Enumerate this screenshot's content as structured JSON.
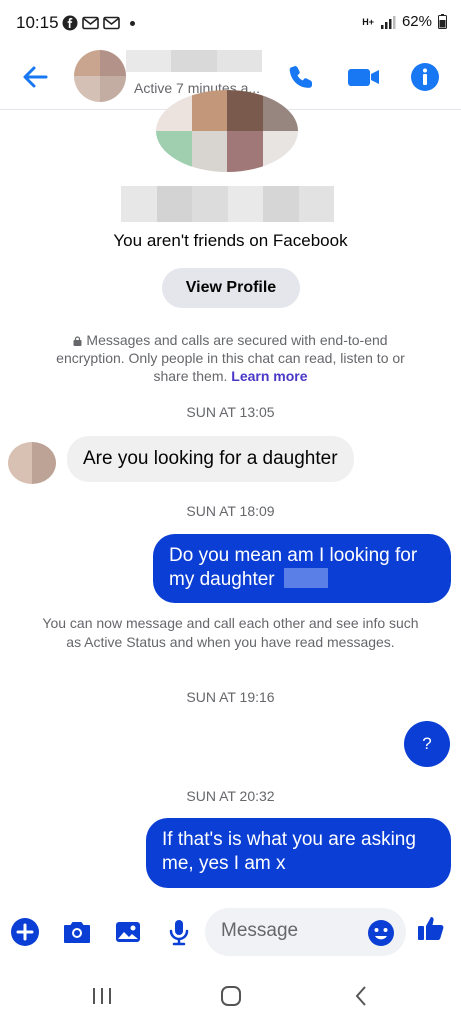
{
  "status_bar": {
    "time": "10:15",
    "network": "H+",
    "battery": "62%"
  },
  "header": {
    "subtitle": "Active 7 minutes a..."
  },
  "profile": {
    "not_friends_text": "You aren't friends on Facebook",
    "view_profile_label": "View Profile"
  },
  "encryption": {
    "text": "Messages and calls are secured with end-to-end encryption. Only people in this chat can read, listen to or share them.",
    "learn_more": "Learn more"
  },
  "conversation": [
    {
      "type": "timestamp",
      "text": "SUN AT 13:05"
    },
    {
      "type": "incoming",
      "text": "Are you looking for a daughter"
    },
    {
      "type": "timestamp",
      "text": "SUN AT 18:09"
    },
    {
      "type": "outgoing",
      "text": "Do you mean am I looking for my daughter"
    },
    {
      "type": "info",
      "text": "You can now message and call each other and see info such as Active Status and when you have read messages."
    },
    {
      "type": "timestamp",
      "text": "SUN AT 19:16"
    },
    {
      "type": "outgoing",
      "text": "?"
    },
    {
      "type": "timestamp",
      "text": "SUN AT 20:32"
    },
    {
      "type": "outgoing",
      "text": "If that's is what you are asking me, yes I am x"
    }
  ],
  "composer": {
    "placeholder": "Message"
  },
  "colors": {
    "accent": "#1877f2",
    "outgoing_bubble": "#0a3ed4",
    "incoming_bubble": "#f0f0f0",
    "learn_more": "#4a38c7"
  },
  "icons": [
    "back-arrow-icon",
    "phone-icon",
    "video-camera-icon",
    "info-icon",
    "plus-icon",
    "camera-icon",
    "gallery-icon",
    "microphone-icon",
    "emoji-icon",
    "thumbs-up-icon",
    "lock-icon"
  ]
}
